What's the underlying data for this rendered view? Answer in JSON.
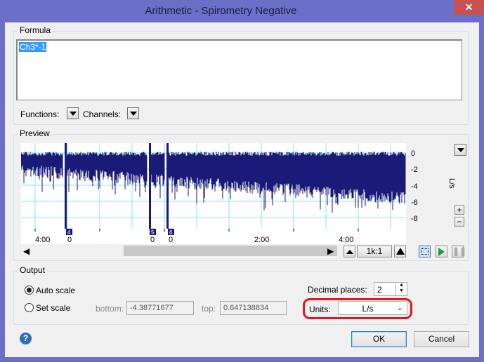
{
  "window": {
    "title": "Arithmetic - Spirometry Negative",
    "close_glyph": "✕"
  },
  "formula": {
    "group_label": "Formula",
    "text": "Ch3*-1",
    "functions_label": "Functions:",
    "channels_label": "Channels:"
  },
  "preview": {
    "group_label": "Preview",
    "y_unit": "L/s",
    "y_ticks": [
      "0",
      "-2",
      "-4",
      "-6",
      "-8"
    ],
    "x_ticks": [
      "4:00",
      "0",
      "0",
      "0",
      "2:00",
      "4:00"
    ],
    "markers": [
      "4",
      "5",
      "6"
    ],
    "zoom_ratio": "1k:1",
    "plus_glyph": "+",
    "minus_glyph": "−",
    "signal_color": "#1a1a78"
  },
  "output": {
    "group_label": "Output",
    "auto_scale": "Auto scale",
    "set_scale": "Set scale",
    "bottom_label": "bottom:",
    "bottom_value": "-4.38771677",
    "top_label": "top:",
    "top_value": "0.647138834",
    "decimal_label": "Decimal places:",
    "decimal_value": "2",
    "units_label": "Units:",
    "units_value": "L/s",
    "highlight_color": "#e8141e"
  },
  "buttons": {
    "ok": "OK",
    "cancel": "Cancel",
    "help": "?"
  }
}
